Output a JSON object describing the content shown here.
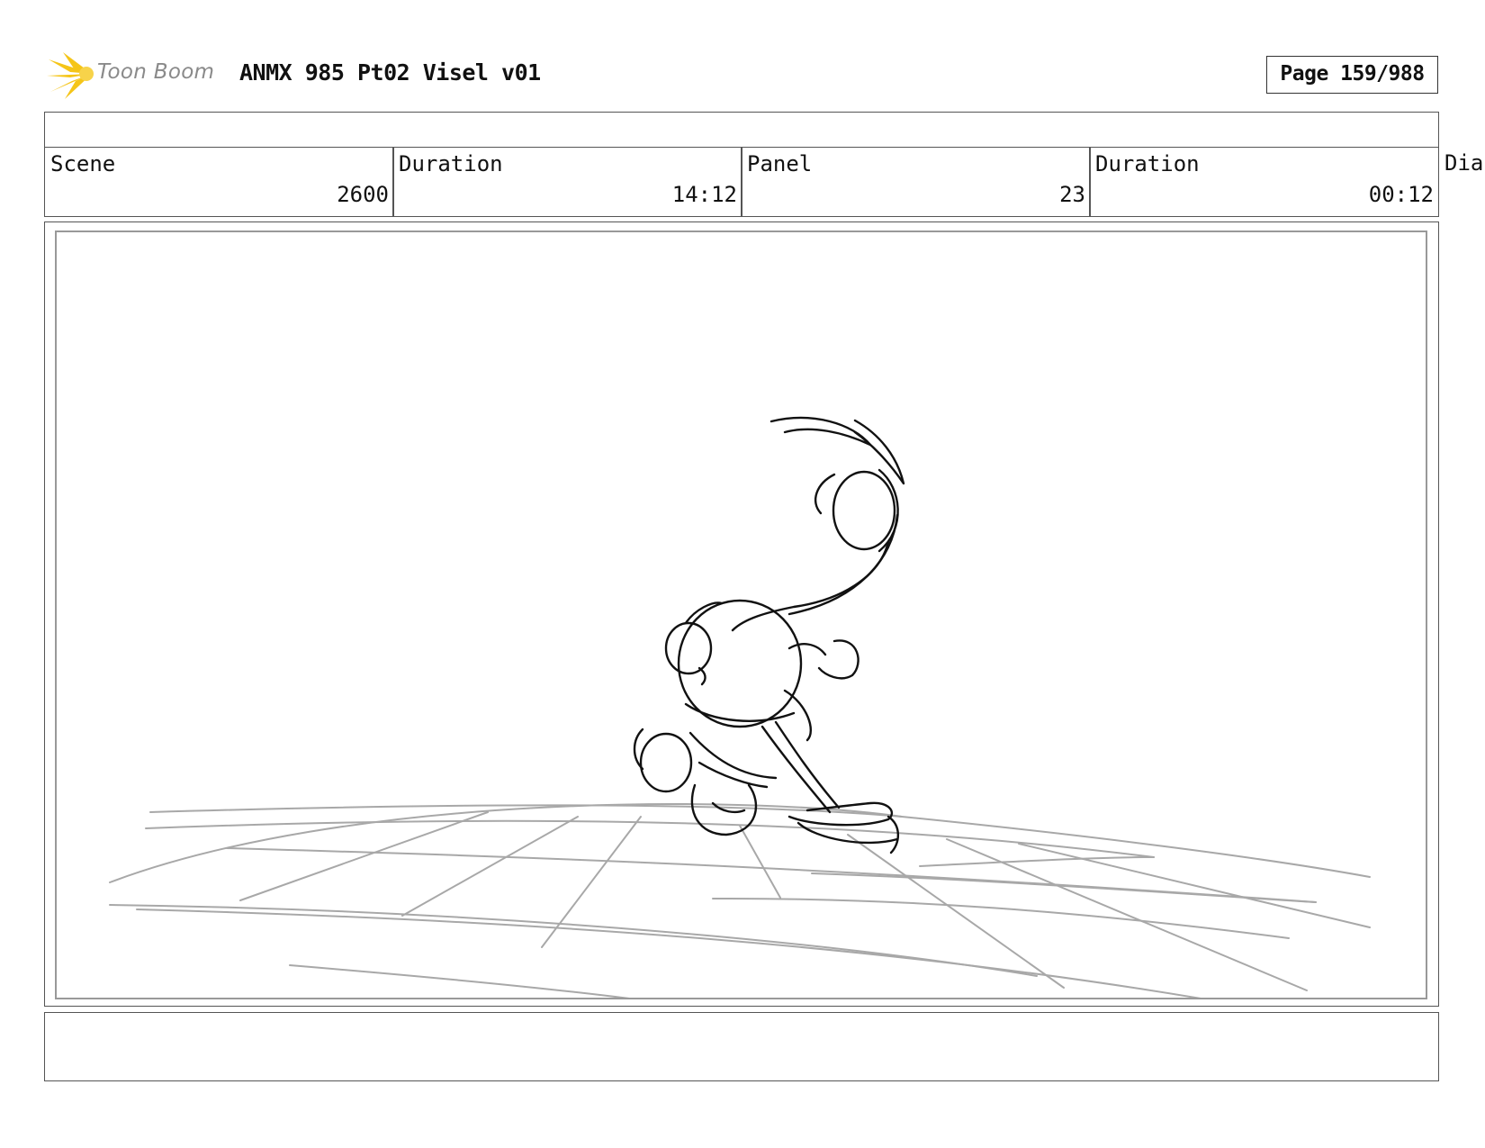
{
  "header": {
    "logo_text": "Toon Boom",
    "project_title": "ANMX 985 Pt02 Visel v01",
    "page_label": "Page 159/988"
  },
  "info": {
    "scene_label": "Scene",
    "scene_value": "2600",
    "scene_duration_label": "Duration",
    "scene_duration_value": "14:12",
    "panel_label": "Panel",
    "panel_value": "23",
    "panel_duration_label": "Duration",
    "panel_duration_value": "00:12",
    "dialog_label_partial": "Dia"
  },
  "colors": {
    "logo_yellow": "#f5c518",
    "sketch_ink": "#111111",
    "floor_grid": "#a8a8a8"
  },
  "icons": {
    "logo": "toon-boom-star-icon"
  }
}
